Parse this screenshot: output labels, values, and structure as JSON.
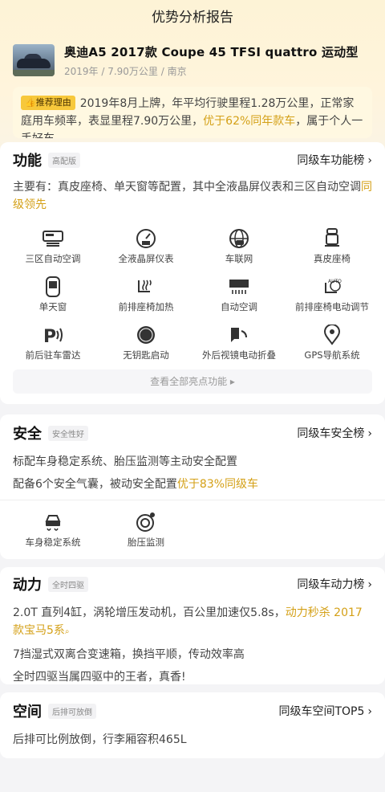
{
  "header": {
    "title": "优势分析报告"
  },
  "car": {
    "name": "奥迪A5 2017款 Coupe 45 TFSI quattro 运动型",
    "meta": "2019年 / 7.90万公里 / 南京"
  },
  "reason": {
    "tag": "推荐理由",
    "text_a": "2019年8月上牌，年平均行驶里程1.28万公里，正常家庭用车频率，表显里程7.90万公里，",
    "highlight": "优于62%同年款车",
    "text_b": "，属于个人一手好车"
  },
  "features": {
    "title": "功能",
    "badge": "高配版",
    "link": "同级车功能榜",
    "desc_a": "主要有：真皮座椅、单天窗等配置，其中全液晶屏仪表和三区自动空调",
    "desc_hl": "同级领先",
    "items": [
      {
        "label": "三区自动空调",
        "icon": "climate-icon"
      },
      {
        "label": "全液晶屏仪表",
        "icon": "lcd-gauge-icon"
      },
      {
        "label": "车联网",
        "icon": "connected-car-icon"
      },
      {
        "label": "真皮座椅",
        "icon": "leather-seat-icon"
      },
      {
        "label": "单天窗",
        "icon": "sunroof-icon"
      },
      {
        "label": "前排座椅加热",
        "icon": "seat-heat-icon"
      },
      {
        "label": "自动空调",
        "icon": "auto-ac-icon"
      },
      {
        "label": "前排座椅电动调节",
        "icon": "seat-adjust-icon"
      },
      {
        "label": "前后驻车雷达",
        "icon": "parking-radar-icon"
      },
      {
        "label": "无钥匙启动",
        "icon": "keyless-start-icon"
      },
      {
        "label": "外后视镜电动折叠",
        "icon": "mirror-fold-icon"
      },
      {
        "label": "GPS导航系统",
        "icon": "gps-icon"
      }
    ],
    "view_all": "查看全部亮点功能"
  },
  "safety": {
    "title": "安全",
    "badge": "安全性好",
    "link": "同级车安全榜",
    "line1": "标配车身稳定系统、胎压监测等主动安全配置",
    "line2_a": "配备6个安全气囊，被动安全配置",
    "line2_hl": "优于83%同级车",
    "items": [
      {
        "label": "车身稳定系统",
        "icon": "stability-icon"
      },
      {
        "label": "胎压监测",
        "icon": "tire-pressure-icon"
      }
    ]
  },
  "power": {
    "title": "动力",
    "badge": "全时四驱",
    "link": "同级车动力榜",
    "line1_a": "2.0T 直列4缸，涡轮增压发动机，百公里加速仅5.8s，",
    "line1_hl": "动力秒杀 2017款宝马5系",
    "line2": "7挡湿式双离合变速箱，换挡平顺，传动效率高",
    "line3": "全时四驱当属四驱中的王者，真香!"
  },
  "space": {
    "title": "空间",
    "badge": "后排可放倒",
    "link": "同级车空间TOP5",
    "line1": "后排可比例放倒，行李厢容积465L"
  },
  "colors": {
    "accent": "#d4a017",
    "tag": "#f7c83b"
  }
}
